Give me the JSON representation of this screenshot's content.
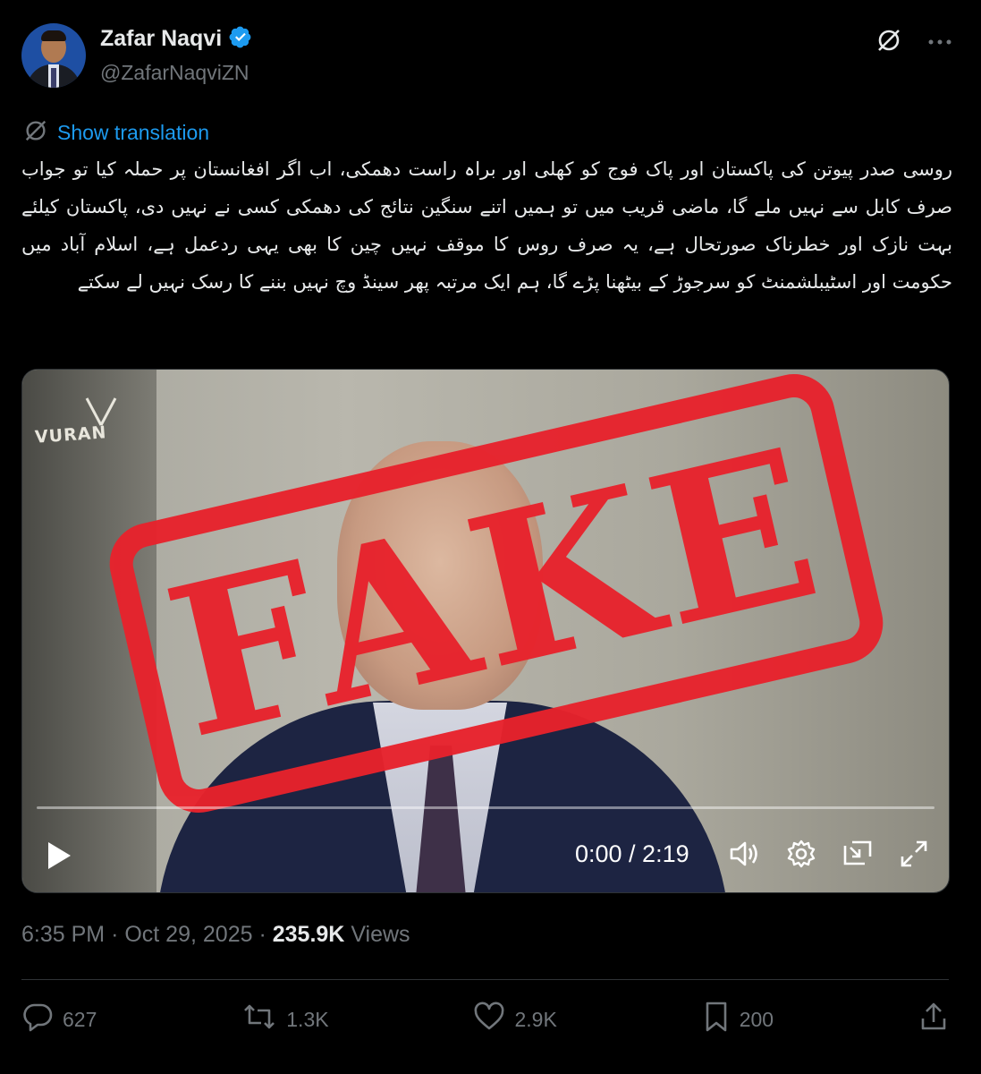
{
  "author": {
    "display_name": "Zafar Naqvi",
    "handle": "@ZafarNaqviZN",
    "verified": true
  },
  "header_icons": [
    "grok-icon",
    "more-icon"
  ],
  "translate": {
    "label": "Show translation"
  },
  "tweet": {
    "text": "روسی صدر پیوتن کی پاکستان اور پاک فوج کو کھلی اور براہ راست دھمکی، اب اگر افغانستان پر حملہ کیا تو جواب صرف کابل سے نہیں ملے گا، ماضی قریب میں تو ہمیں اتنے سنگین نتائج کی دھمکی کسی نے نہیں دی، پاکستان کیلئے بہت نازک اور خطرناک صورتحال ہے، یہ صرف روس کا موقف نہیں چین کا بھی یہی ردعمل ہے، اسلام آباد میں حکومت اور اسٹیبلشمنٹ کو سرجوڑ کے بیٹھنا پڑے گا، ہم ایک مرتبہ پھر سینڈ وچ نہیں بننے کا رسک نہیں لے سکتے"
  },
  "video": {
    "watermark_logo": "VURAN",
    "stamp_text": "FAKE",
    "time_display": "0:00 / 2:19",
    "progress": 0
  },
  "meta": {
    "time": "6:35 PM",
    "date": "Oct 29, 2025",
    "separator": "·",
    "views_count": "235.9K",
    "views_label": "Views"
  },
  "actions": {
    "replies": "627",
    "reposts": "1.3K",
    "likes": "2.9K",
    "bookmarks": "200"
  },
  "colors": {
    "background": "#000000",
    "text": "#e7e9ea",
    "muted": "#71767b",
    "accent": "#1d9bf0",
    "stamp_red": "#e8222c"
  }
}
